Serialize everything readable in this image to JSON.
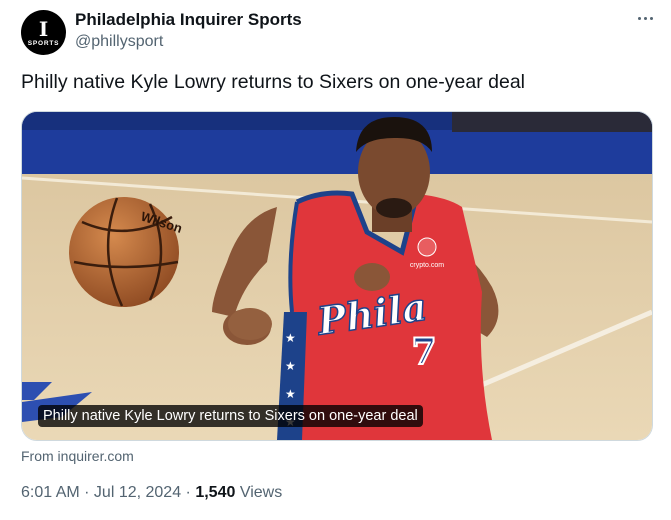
{
  "account": {
    "avatar_monogram": "I",
    "avatar_word": "SPORTS",
    "display_name": "Philadelphia Inquirer Sports",
    "handle": "@phillysport"
  },
  "tweet": {
    "text": "Philly native Kyle Lowry returns to Sixers on one-year deal"
  },
  "card": {
    "image_caption": "Philly native Kyle Lowry returns to Sixers on one-year deal",
    "jersey_wordmark": "Phila",
    "jersey_number": "7",
    "sponsor_text": "crypto.com",
    "ball_brand": "Wilson",
    "source": "From inquirer.com"
  },
  "meta": {
    "time": "6:01 AM",
    "separator1": " · ",
    "date": "Jul 12, 2024",
    "separator2": " · ",
    "views_count": "1,540",
    "views_label": " Views"
  },
  "colors": {
    "jersey_red": "#e0363b",
    "jersey_blue": "#1d428a",
    "court_blue": "#1e3c9c",
    "court_floor": "#e4cfa9"
  }
}
